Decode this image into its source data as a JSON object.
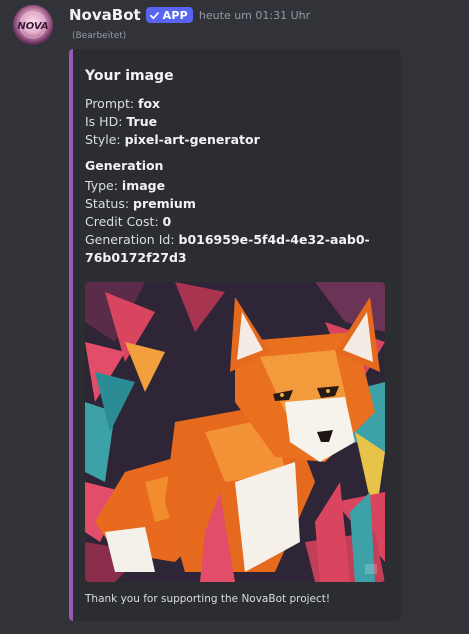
{
  "message": {
    "username": "NovaBot",
    "badge": "APP",
    "timestamp": "heute um 01:31 Uhr",
    "edited": "(Bearbeitet)"
  },
  "embed": {
    "title": "Your image",
    "accent_color": "#9b59b6",
    "fields": {
      "prompt_label": "Prompt: ",
      "prompt_value": "fox",
      "hd_label": "Is HD: ",
      "hd_value": "True",
      "style_label": "Style: ",
      "style_value": "pixel-art-generator"
    },
    "generation": {
      "title": "Generation",
      "type_label": "Type: ",
      "type_value": "image",
      "status_label": "Status: ",
      "status_value": "premium",
      "cost_label": "Credit Cost: ",
      "cost_value": "0",
      "id_label": "Generation Id: ",
      "id_value": "b016959e-5f4d-4e32-aab0-76b0172f27d3"
    },
    "footer": "Thank you for supporting the NovaBot project!"
  },
  "avatar_text": "NOVA",
  "colors": {
    "background": "#313338",
    "embed_background": "#2b2d31",
    "badge": "#5865f2"
  }
}
